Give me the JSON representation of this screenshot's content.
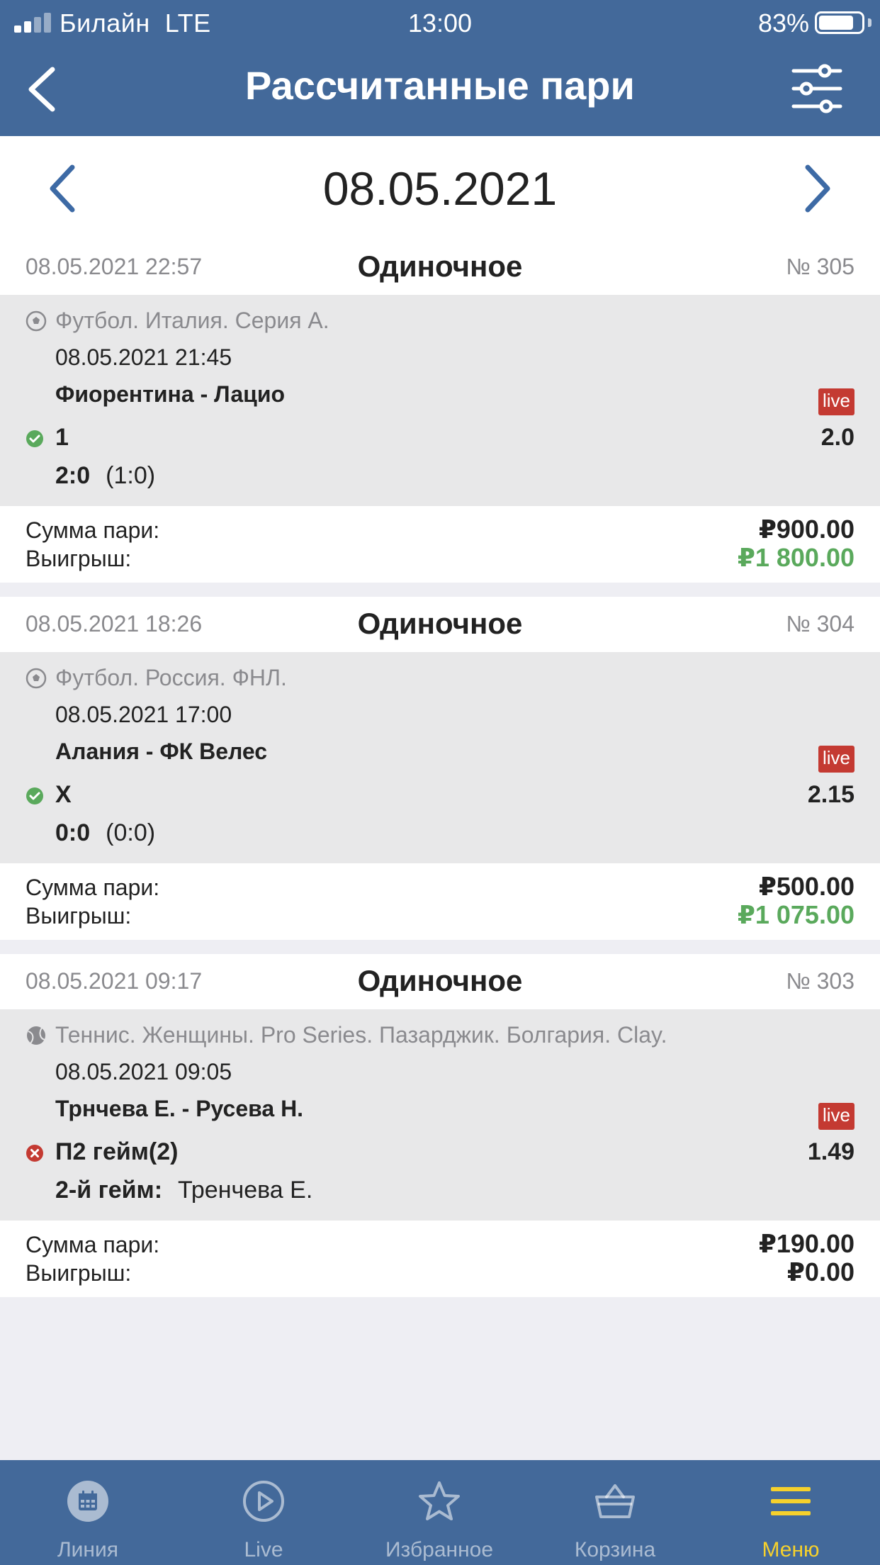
{
  "status_bar": {
    "carrier": "Билайн",
    "network": "LTE",
    "time": "13:00",
    "battery_percent": "83%",
    "battery_level": 0.83
  },
  "header": {
    "title": "Рассчитанные пари",
    "back_icon": "chevron-left-icon",
    "filter_icon": "sliders-icon"
  },
  "date_nav": {
    "date": "08.05.2021"
  },
  "bets": [
    {
      "placed_at": "08.05.2021 22:57",
      "type": "Одиночное",
      "number": "№ 305",
      "sport_icon": "soccer-ball-icon",
      "league": "Футбол. Италия. Серия А.",
      "event_date": "08.05.2021 21:45",
      "teams": "Фиорентина - Лацио",
      "live_label": "live",
      "outcome": "won",
      "selection": "1",
      "odds": "2.0",
      "score_main": "2:0",
      "score_detail": "(1:0)",
      "stake_label": "Сумма пари:",
      "stake": "₽900.00",
      "win_label": "Выигрыш:",
      "win": "₽1 800.00"
    },
    {
      "placed_at": "08.05.2021 18:26",
      "type": "Одиночное",
      "number": "№ 304",
      "sport_icon": "soccer-ball-icon",
      "league": "Футбол. Россия. ФНЛ.",
      "event_date": "08.05.2021 17:00",
      "teams": "Алания - ФК Велес",
      "live_label": "live",
      "outcome": "won",
      "selection": "X",
      "odds": "2.15",
      "score_main": "0:0",
      "score_detail": "(0:0)",
      "stake_label": "Сумма пари:",
      "stake": "₽500.00",
      "win_label": "Выигрыш:",
      "win": "₽1 075.00"
    },
    {
      "placed_at": "08.05.2021 09:17",
      "type": "Одиночное",
      "number": "№ 303",
      "sport_icon": "tennis-ball-icon",
      "league": "Теннис. Женщины. Pro Series. Пазарджик. Болгария. Clay.",
      "event_date": "08.05.2021 09:05",
      "teams": "Трнчева Е. - Русева Н.",
      "live_label": "live",
      "outcome": "lost",
      "selection": "П2 гейм(2)",
      "odds": "1.49",
      "score_main": "2-й гейм:",
      "score_detail": "Тренчева Е.",
      "stake_label": "Сумма пари:",
      "stake": "₽190.00",
      "win_label": "Выигрыш:",
      "win": "₽0.00"
    }
  ],
  "tabs": [
    {
      "label": "Линия",
      "icon": "calendar-icon"
    },
    {
      "label": "Live",
      "icon": "play-circle-icon"
    },
    {
      "label": "Избранное",
      "icon": "star-icon"
    },
    {
      "label": "Корзина",
      "icon": "basket-icon"
    },
    {
      "label": "Меню",
      "icon": "menu-icon",
      "active": true
    }
  ],
  "colors": {
    "header_bg": "#43699a",
    "win_green": "#5aa95c",
    "live_red": "#c43a32",
    "lost_red": "#c43a32",
    "tab_active": "#f6d12c",
    "card_grey": "#e8e8e9",
    "page_bg": "#eeeef3"
  }
}
